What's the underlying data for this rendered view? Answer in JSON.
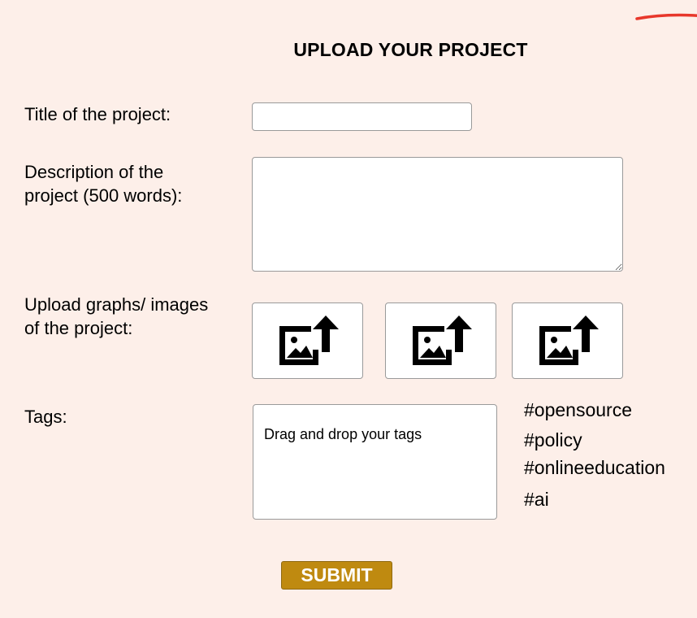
{
  "page": {
    "title": "UPLOAD YOUR PROJECT"
  },
  "form": {
    "title_label": "Title of the project:",
    "title_value": "",
    "description_label_line1": "Description of the",
    "description_label_line2": "project (500 words):",
    "description_value": "",
    "upload_label_line1": "Upload graphs/ images",
    "upload_label_line2": "of the project:",
    "upload_slots": [
      {
        "icon": "image-upload-icon"
      },
      {
        "icon": "image-upload-icon"
      },
      {
        "icon": "image-upload-icon"
      }
    ],
    "tags_label": "Tags:",
    "tags_placeholder": "Drag and drop your tags",
    "available_tags": [
      "#opensource",
      "#policy",
      "#onlineeducation",
      "#ai"
    ],
    "submit_label": "SUBMIT"
  },
  "colors": {
    "background": "#fdefe9",
    "submit_button": "#bf8a10",
    "corner_mark": "#e8372b"
  }
}
